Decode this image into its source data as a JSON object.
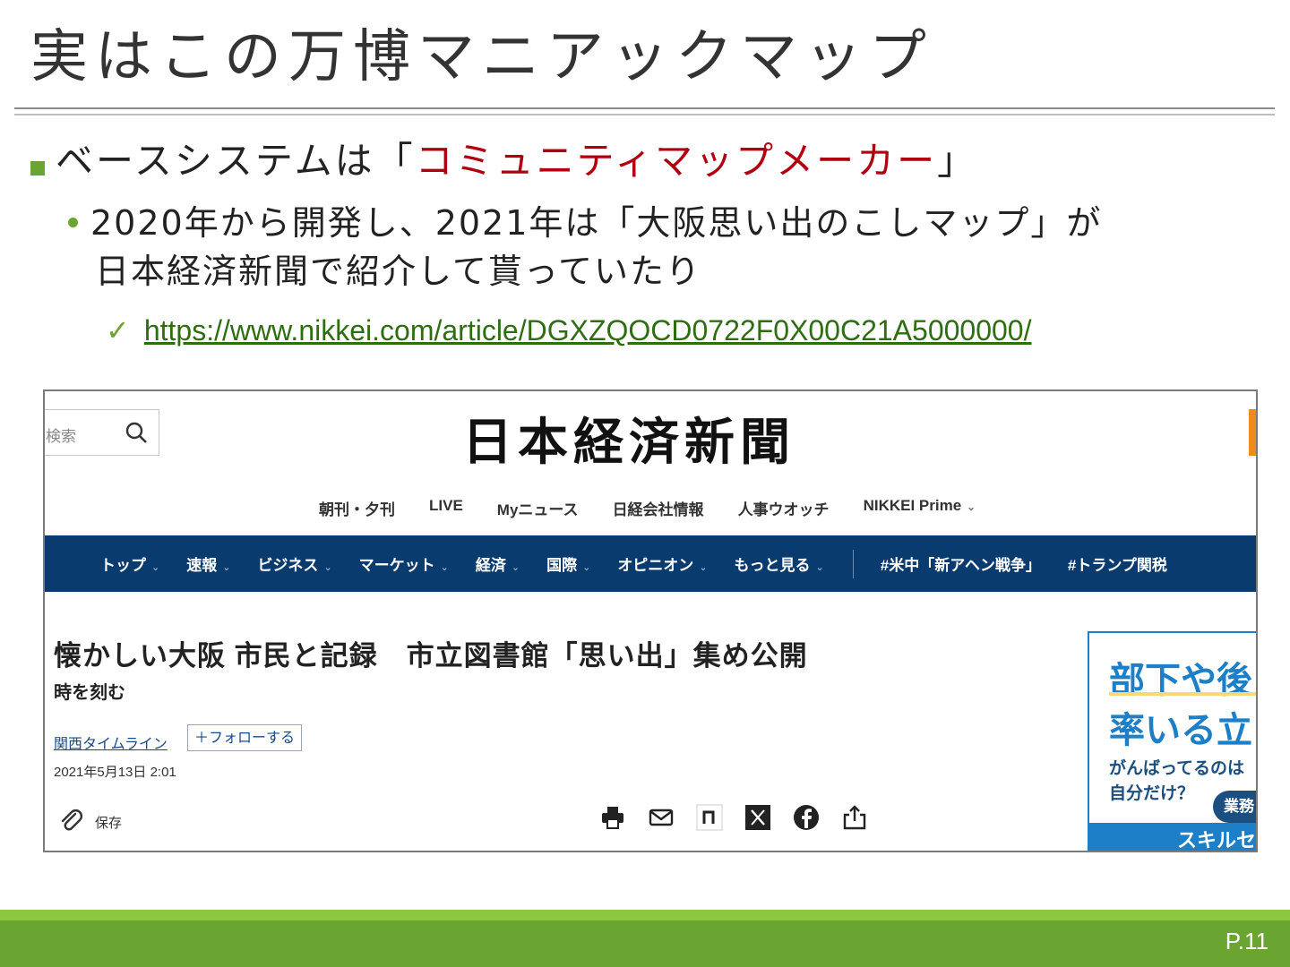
{
  "slide": {
    "title": "実はこの万博マニアックマップ",
    "bullet1_pre": "ベースシステムは「",
    "bullet1_red": "コミュニティマップメーカー",
    "bullet1_post": "」",
    "bullet2_line1": "2020年から開発し、2021年は「大阪思い出のこしマップ」が",
    "bullet2_line2": "日本経済新聞で紹介して貰っていたり",
    "check_mark": "✓",
    "link": "https://www.nikkei.com/article/DGXZQOCD0722F0X00C21A5000000/",
    "page_number": "P.11"
  },
  "screenshot": {
    "search_placeholder": "検索",
    "masthead": "日本経済新聞",
    "subnav": [
      "朝刊・夕刊",
      "LIVE",
      "Myニュース",
      "日経会社情報",
      "人事ウオッチ",
      "NIKKEI Prime"
    ],
    "mainnav": [
      "トップ",
      "速報",
      "ビジネス",
      "マーケット",
      "経済",
      "国際",
      "オピニオン",
      "もっと見る"
    ],
    "topics": [
      "#米中「新アヘン戦争」",
      "#トランプ関税"
    ],
    "chevron": "⌄",
    "article_title": "懐かしい大阪 市民と記録　市立図書館「思い出」集め公開",
    "series": "時を刻む",
    "timeline_link": "関西タイムライン",
    "follow_button": "＋フォローする",
    "date": "2021年5月13日 2:01",
    "save_label": "保存",
    "ad": {
      "line1": "部下や後",
      "line2": "率いる立",
      "line3": "がんばってるのは",
      "line4": "自分だけ？",
      "pill": "業務",
      "footer": "スキルセ"
    }
  },
  "colors": {
    "accent_green": "#6aa531",
    "light_green": "#8dc63f",
    "red_text": "#b00010",
    "nikkei_navy": "#0a3b6f",
    "link_green": "#2e6e12"
  }
}
